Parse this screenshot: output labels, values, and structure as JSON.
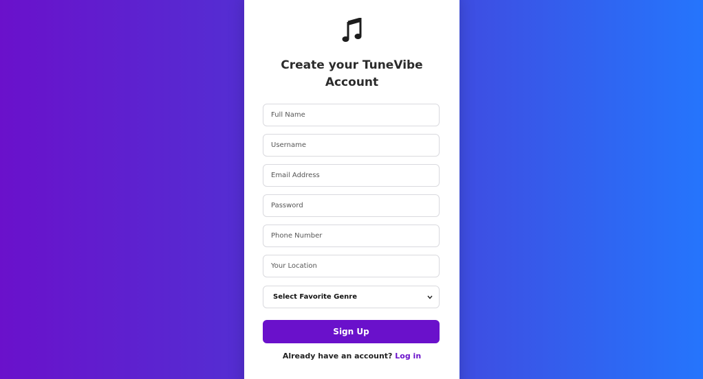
{
  "app": {
    "logo_icon": "music-note-icon",
    "title": "Create your TuneVibe Account"
  },
  "form": {
    "full_name_placeholder": "Full Name",
    "username_placeholder": "Username",
    "email_placeholder": "Email Address",
    "password_placeholder": "Password",
    "phone_placeholder": "Phone Number",
    "location_placeholder": "Your Location",
    "genre_selected": "Select Favorite Genre",
    "signup_label": "Sign Up"
  },
  "footer": {
    "prompt": "Already have an account?",
    "login_label": "Log in"
  },
  "colors": {
    "gradient_start": "#6a11cb",
    "gradient_end": "#2575fc",
    "accent": "#6a11cb"
  }
}
